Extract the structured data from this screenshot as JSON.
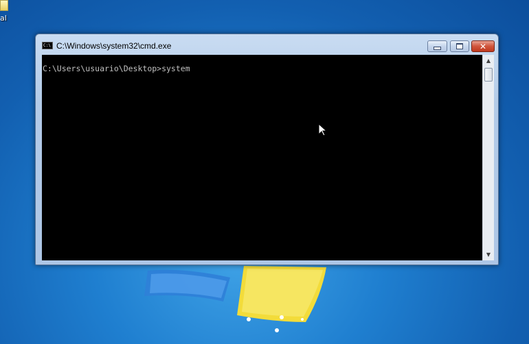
{
  "desktop": {
    "icon_label": "al"
  },
  "window": {
    "title": "C:\\Windows\\system32\\cmd.exe",
    "app_icon_text": "C:\\",
    "controls": {
      "minimize": "minimize-icon",
      "maximize": "maximize-icon",
      "close": "✕"
    }
  },
  "console": {
    "lines": [
      "C:\\Users\\usuario\\Desktop>system"
    ]
  },
  "scrollbar": {
    "up_arrow": "▲",
    "down_arrow": "▼"
  },
  "colors": {
    "console_bg": "#000000",
    "console_text": "#c0c0c0",
    "close_button": "#c9462c",
    "chrome": "#b3cbe8"
  }
}
